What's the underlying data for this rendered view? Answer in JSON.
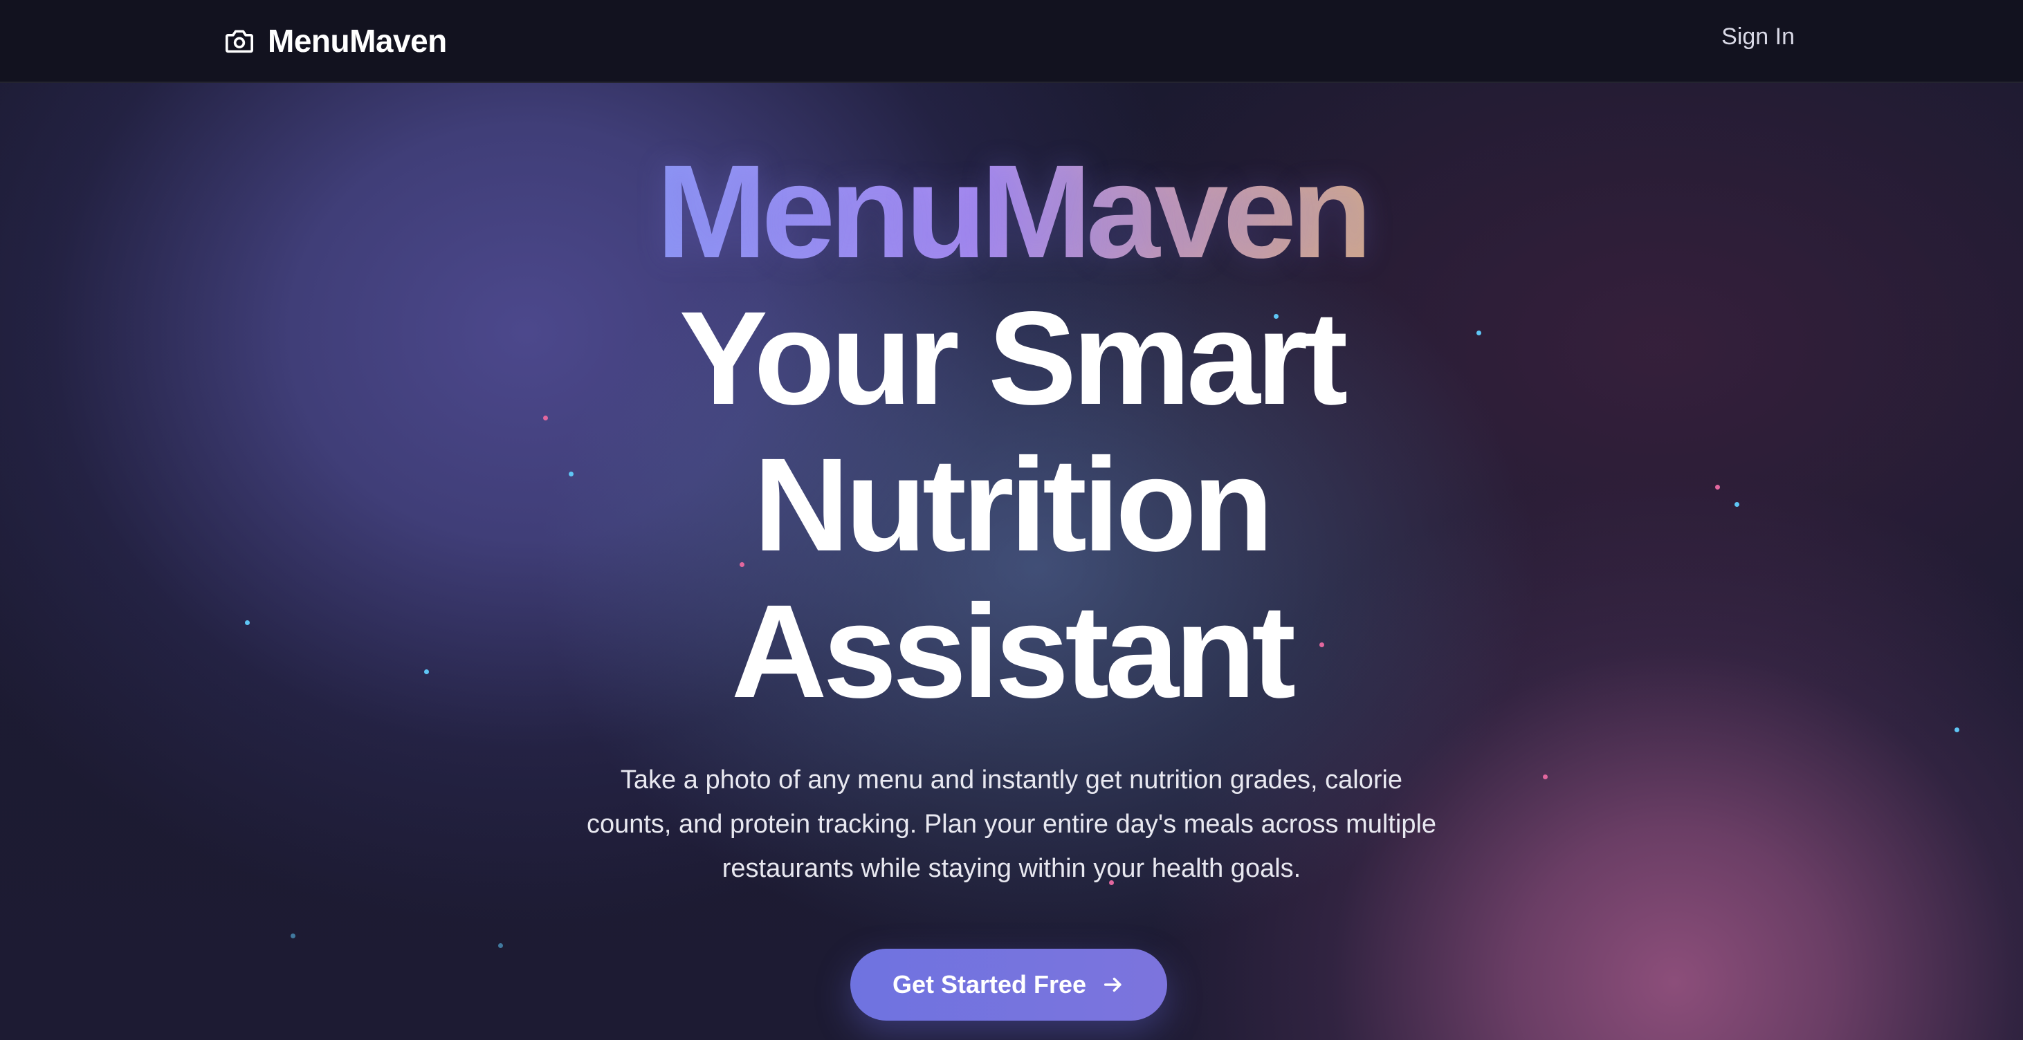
{
  "nav": {
    "brand": "MenuMaven",
    "brand_icon": "camera-icon",
    "sign_in": "Sign In"
  },
  "hero": {
    "brand_title": "MenuMaven",
    "headline_lines": [
      "Your Smart",
      "Nutrition",
      "Assistant"
    ],
    "subtitle": "Take a photo of any menu and instantly get nutrition grades, calorie counts, and protein tracking. Plan your entire day's meals across multiple restaurants while staying within your health goals."
  },
  "cta": {
    "label": "Get Started Free",
    "icon": "arrow-right-icon"
  },
  "colors": {
    "accent": "#7173e0",
    "title_gradient_start": "#8e97f6",
    "title_gradient_end": "#d4aa8a",
    "particle_blue": "#5fc6f5",
    "particle_pink": "#e2679e"
  }
}
